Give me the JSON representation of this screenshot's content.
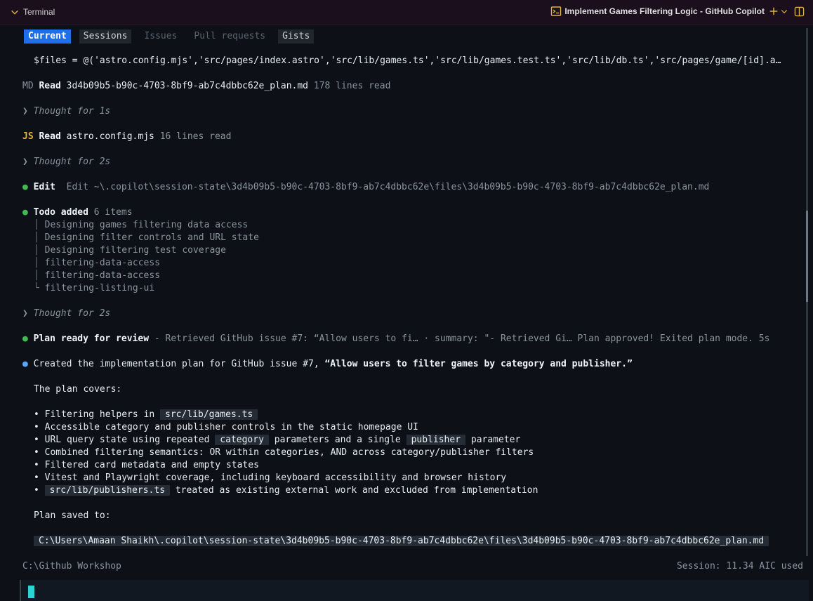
{
  "panel": {
    "title": "Terminal"
  },
  "session_title": "Implement Games Filtering Logic - GitHub Copilot",
  "tabs": [
    "Current",
    "Sessions",
    "Issues",
    "Pull requests",
    "Gists"
  ],
  "log": {
    "cmd": "$files = @('astro.config.mjs','src/pages/index.astro','src/lib/games.ts','src/lib/games.test.ts','src/lib/db.ts','src/pages/game/[id].a…",
    "read1": {
      "badge": "MD",
      "verb": "Read",
      "file": "3d4b09b5-b90c-4703-8bf9-ab7c4dbbc62e_plan.md",
      "meta": "178 lines read"
    },
    "thought1": "Thought for 1s",
    "read2": {
      "badge": "JS",
      "verb": "Read",
      "file": "astro.config.mjs",
      "meta": "16 lines read"
    },
    "thought2": "Thought for 2s",
    "edit": {
      "dot": "●",
      "verb": "Edit",
      "detail": "Edit ~\\.copilot\\session-state\\3d4b09b5-b90c-4703-8bf9-ab7c4dbbc62e\\files\\3d4b09b5-b90c-4703-8bf9-ab7c4dbbc62e_plan.md"
    },
    "todo": {
      "verb": "Todo added",
      "meta": "6 items",
      "items": [
        "Designing games filtering data access",
        "Designing filter controls and URL state",
        "Designing filtering test coverage",
        "filtering-data-access",
        "filtering-data-access",
        "filtering-listing-ui"
      ]
    },
    "thought3": "Thought for 2s",
    "plan_ready": {
      "verb": "Plan ready for review",
      "detail": "- Retrieved GitHub issue #7: “Allow users to fi… · summary: \"- Retrieved Gi… Plan approved! Exited plan mode. 5s"
    },
    "created": {
      "prefix": "Created the implementation plan for GitHub issue #7, ",
      "quote": "“Allow users to filter games by category and publisher.”"
    },
    "covers": "The plan covers:",
    "bullets": {
      "b1": {
        "pre": "Filtering helpers in",
        "code": "src/lib/games.ts"
      },
      "b2": "Accessible category and publisher controls in the static homepage UI",
      "b3": {
        "pre": "URL query state using repeated",
        "code1": "category",
        "mid": "parameters and a single",
        "code2": "publisher",
        "post": "parameter"
      },
      "b4": "Combined filtering semantics: OR within categories, AND across category/publisher filters",
      "b5": "Filtered card metadata and empty states",
      "b6": "Vitest and Playwright coverage, including keyboard accessibility and browser history",
      "b7": {
        "code": "src/lib/publishers.ts",
        "post": "treated as existing external work and excluded from implementation"
      }
    },
    "saved_label": "Plan saved to:",
    "saved_path": "C:\\Users\\Amaan Shaikh\\.copilot\\session-state\\3d4b09b5-b90c-4703-8bf9-ab7c4dbbc62e\\files\\3d4b09b5-b90c-4703-8bf9-ab7c4dbbc62e_plan.md"
  },
  "status": {
    "cwd": "C:\\Github Workshop",
    "usage": "Session: 11.34 AIC used"
  },
  "colors": {
    "accent": "#1f6feb",
    "success": "#3fb950",
    "info": "#58a6ff",
    "cursor": "#2ad4d4"
  }
}
